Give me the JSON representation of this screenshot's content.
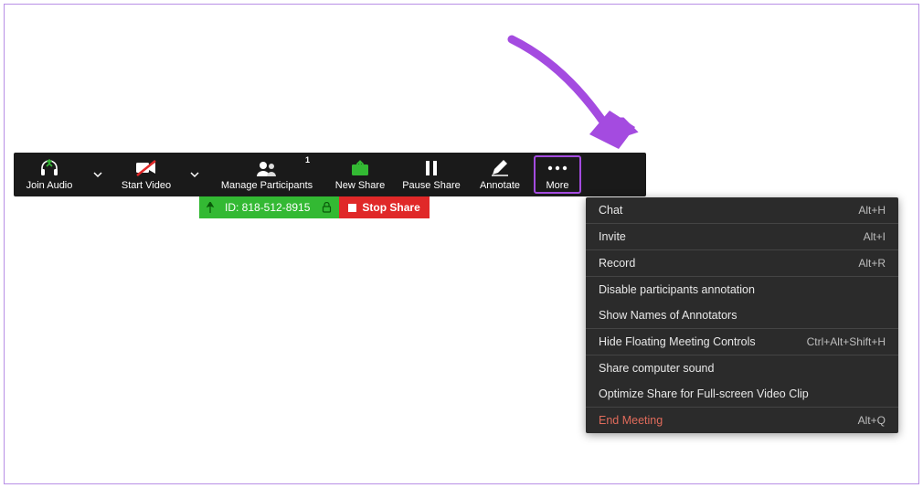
{
  "toolbar": {
    "join_audio": "Join Audio",
    "start_video": "Start Video",
    "manage_participants": "Manage Participants",
    "participants_badge": "1",
    "new_share": "New Share",
    "pause_share": "Pause Share",
    "annotate": "Annotate",
    "more": "More"
  },
  "status": {
    "meeting_id": "ID: 818-512-8915",
    "stop_share": "Stop Share"
  },
  "menu": {
    "chat": {
      "label": "Chat",
      "shortcut": "Alt+H"
    },
    "invite": {
      "label": "Invite",
      "shortcut": "Alt+I"
    },
    "record": {
      "label": "Record",
      "shortcut": "Alt+R"
    },
    "disable_annotation": {
      "label": "Disable participants annotation"
    },
    "show_annotators": {
      "label": "Show Names of Annotators"
    },
    "hide_controls": {
      "label": "Hide Floating Meeting Controls",
      "shortcut": "Ctrl+Alt+Shift+H"
    },
    "share_sound": {
      "label": "Share computer sound"
    },
    "optimize_video": {
      "label": "Optimize Share for Full-screen Video Clip"
    },
    "end_meeting": {
      "label": "End Meeting",
      "shortcut": "Alt+Q"
    }
  },
  "colors": {
    "accent_green": "#33b933",
    "accent_red": "#e02828",
    "highlight_purple": "#a44be0"
  }
}
